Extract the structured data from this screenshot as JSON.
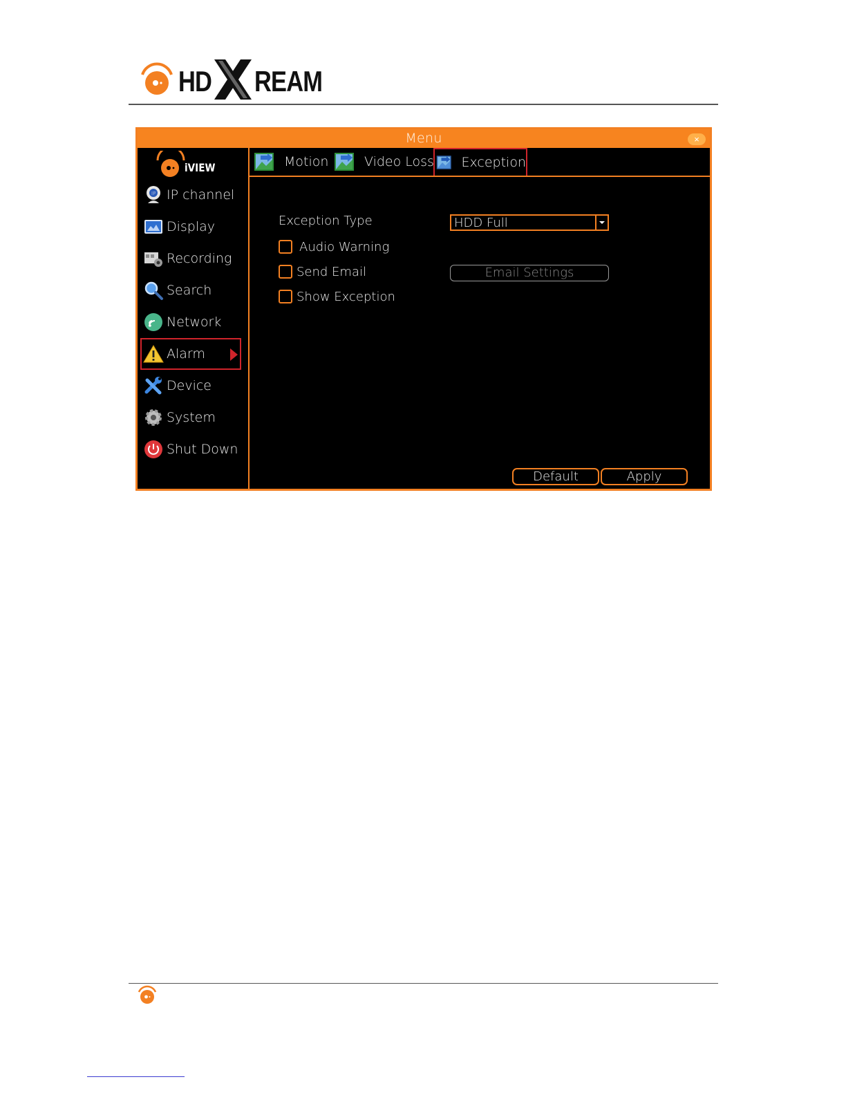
{
  "brand": {
    "word_hd": "HD",
    "word_x": "X",
    "word_ream": "REAM",
    "accent": "#f38022"
  },
  "window": {
    "title": "Menu",
    "close_icon": "×",
    "frame_color": "#f38022",
    "selection_color": "#d0242b"
  },
  "sidebar": {
    "logo_text": "iVIEW",
    "items": [
      {
        "label": "IP channel",
        "icon": "ip-camera-icon"
      },
      {
        "label": "Display",
        "icon": "display-icon"
      },
      {
        "label": "Recording",
        "icon": "recording-icon"
      },
      {
        "label": "Search",
        "icon": "search-icon"
      },
      {
        "label": "Network",
        "icon": "network-icon"
      },
      {
        "label": "Alarm",
        "icon": "alarm-warning-icon",
        "active": true
      },
      {
        "label": "Device",
        "icon": "device-tools-icon"
      },
      {
        "label": "System",
        "icon": "system-gear-icon"
      },
      {
        "label": "Shut Down",
        "icon": "power-icon"
      }
    ]
  },
  "tabs": [
    {
      "label": "Motion",
      "icon": "motion-icon"
    },
    {
      "label": "Video Loss",
      "icon": "video-loss-icon"
    },
    {
      "label": "Exception",
      "icon": "exception-icon",
      "active": true
    }
  ],
  "form": {
    "exception_type_label": "Exception Type",
    "exception_type_value": "HDD Full",
    "audio_warning_label": "Audio Warning",
    "audio_warning_checked": false,
    "send_email_label": "Send Email",
    "send_email_checked": false,
    "show_exception_label": "Show Exception",
    "show_exception_checked": false,
    "email_settings_label": "Email Settings"
  },
  "footer_buttons": {
    "default_label": "Default",
    "apply_label": "Apply"
  }
}
